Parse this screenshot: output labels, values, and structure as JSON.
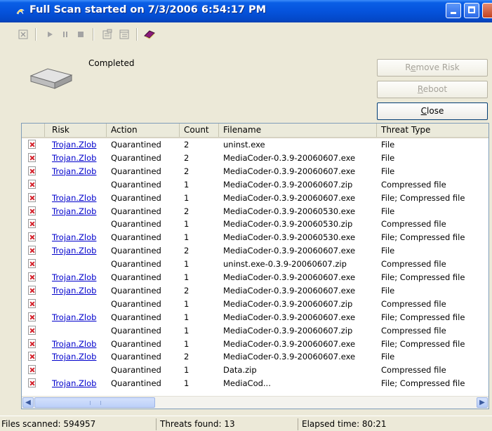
{
  "window": {
    "title": "Full Scan started on 7/3/2006 6:54:17 PM"
  },
  "toolbar": {
    "icons": [
      "delete-icon",
      "play-icon",
      "pause-icon",
      "stop-icon",
      "properties-icon",
      "details-icon",
      "book-icon"
    ]
  },
  "scan": {
    "status": "Completed"
  },
  "buttons": {
    "remove_risk_pre": "R",
    "remove_risk_u": "e",
    "remove_risk_post": "move Risk",
    "reboot_u": "R",
    "reboot_post": "eboot",
    "close_u": "C",
    "close_post": "lose"
  },
  "columns": [
    "Risk",
    "Action",
    "Count",
    "Filename",
    "Threat Type"
  ],
  "rows": [
    {
      "risk": "Trojan.Zlob",
      "action": "Quarantined",
      "count": "2",
      "filename": "uninst.exe",
      "type": "File"
    },
    {
      "risk": "Trojan.Zlob",
      "action": "Quarantined",
      "count": "2",
      "filename": "MediaCoder-0.3.9-20060607.exe",
      "type": "File"
    },
    {
      "risk": "Trojan.Zlob",
      "action": "Quarantined",
      "count": "2",
      "filename": "MediaCoder-0.3.9-20060607.exe",
      "type": "File"
    },
    {
      "risk": "",
      "action": "Quarantined",
      "count": "1",
      "filename": "MediaCoder-0.3.9-20060607.zip",
      "type": "Compressed file"
    },
    {
      "risk": "Trojan.Zlob",
      "action": "Quarantined",
      "count": "1",
      "filename": "MediaCoder-0.3.9-20060607.exe",
      "type": "File; Compressed file"
    },
    {
      "risk": "Trojan.Zlob",
      "action": "Quarantined",
      "count": "2",
      "filename": "MediaCoder-0.3.9-20060530.exe",
      "type": "File"
    },
    {
      "risk": "",
      "action": "Quarantined",
      "count": "1",
      "filename": "MediaCoder-0.3.9-20060530.zip",
      "type": "Compressed file"
    },
    {
      "risk": "Trojan.Zlob",
      "action": "Quarantined",
      "count": "1",
      "filename": "MediaCoder-0.3.9-20060530.exe",
      "type": "File; Compressed file"
    },
    {
      "risk": "Trojan.Zlob",
      "action": "Quarantined",
      "count": "2",
      "filename": "MediaCoder-0.3.9-20060607.exe",
      "type": "File"
    },
    {
      "risk": "",
      "action": "Quarantined",
      "count": "1",
      "filename": "uninst.exe-0.3.9-20060607.zip",
      "type": "Compressed file"
    },
    {
      "risk": "Trojan.Zlob",
      "action": "Quarantined",
      "count": "1",
      "filename": "MediaCoder-0.3.9-20060607.exe",
      "type": "File; Compressed file"
    },
    {
      "risk": "Trojan.Zlob",
      "action": "Quarantined",
      "count": "2",
      "filename": "MediaCoder-0.3.9-20060607.exe",
      "type": "File"
    },
    {
      "risk": "",
      "action": "Quarantined",
      "count": "1",
      "filename": "MediaCoder-0.3.9-20060607.zip",
      "type": "Compressed file"
    },
    {
      "risk": "Trojan.Zlob",
      "action": "Quarantined",
      "count": "1",
      "filename": "MediaCoder-0.3.9-20060607.exe",
      "type": "File; Compressed file"
    },
    {
      "risk": "",
      "action": "Quarantined",
      "count": "1",
      "filename": "MediaCoder-0.3.9-20060607.zip",
      "type": "Compressed file"
    },
    {
      "risk": "Trojan.Zlob",
      "action": "Quarantined",
      "count": "1",
      "filename": "MediaCoder-0.3.9-20060607.exe",
      "type": "File; Compressed file"
    },
    {
      "risk": "Trojan.Zlob",
      "action": "Quarantined",
      "count": "2",
      "filename": "MediaCoder-0.3.9-20060607.exe",
      "type": "File"
    },
    {
      "risk": "",
      "action": "Quarantined",
      "count": "1",
      "filename": "Data.zip",
      "type": "Compressed file"
    },
    {
      "risk": "Trojan.Zlob",
      "action": "Quarantined",
      "count": "1",
      "filename": "MediaCod...",
      "type": "File; Compressed file"
    }
  ],
  "statusbar": {
    "files_scanned": "Files scanned: 594957",
    "threats_found": "Threats found: 13",
    "elapsed": "Elapsed time: 80:21"
  },
  "colors": {
    "titlebar": "#0553dc",
    "link": "#0000cc",
    "frame": "#ece9d8"
  }
}
